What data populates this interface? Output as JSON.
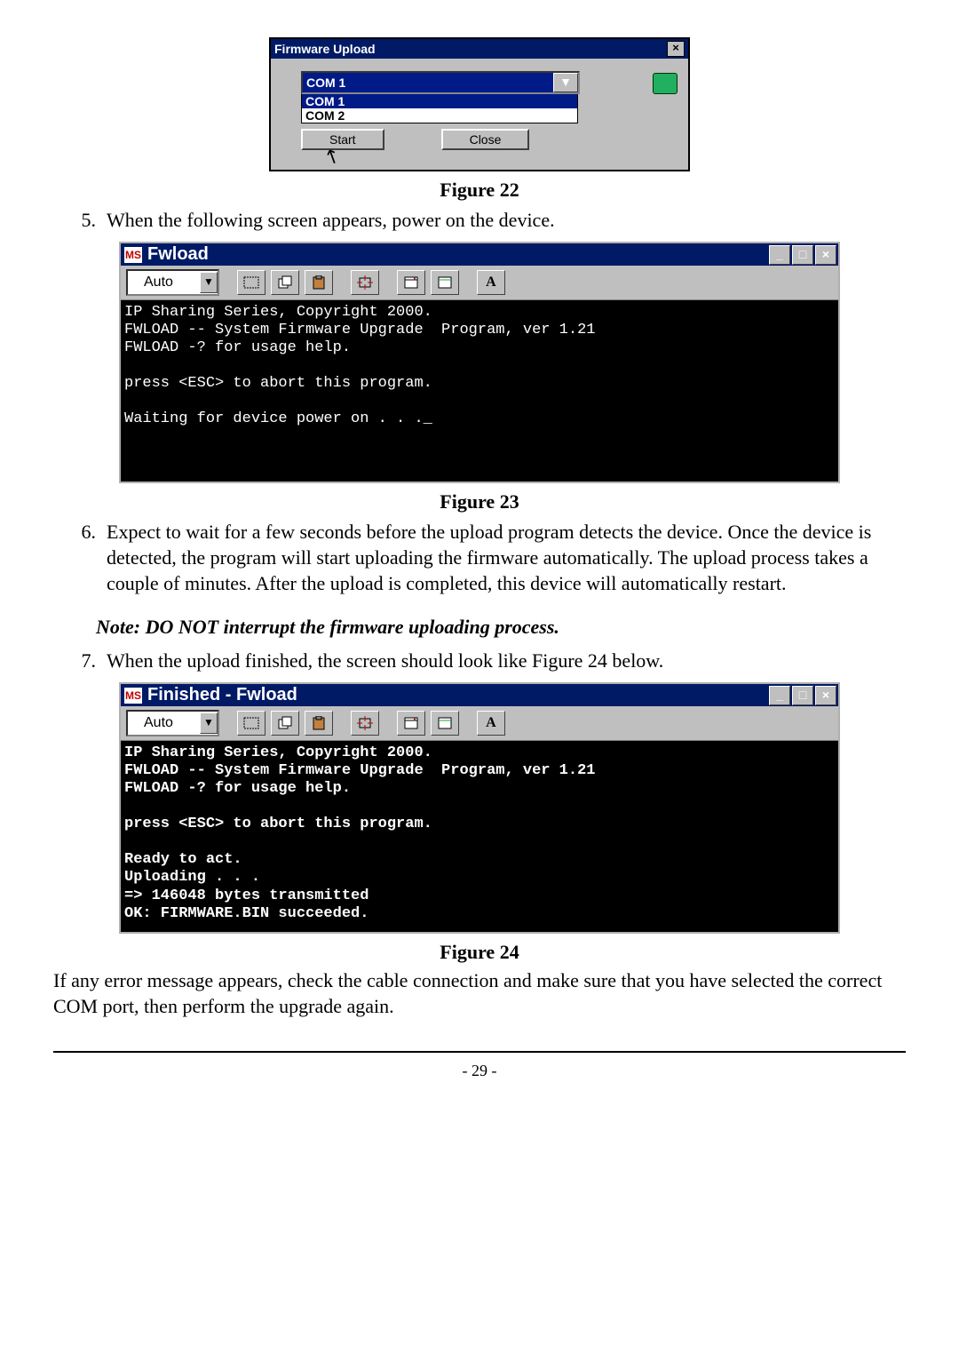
{
  "fig22": {
    "title": "Firmware Upload",
    "selected": "COM 1",
    "option1": "COM 1",
    "option2": "COM 2",
    "start": "Start",
    "close": "Close",
    "caption": "Figure 22"
  },
  "step5": {
    "num": "5.",
    "text": "When the following screen appears, power on the device."
  },
  "fig23": {
    "title": "Fwload",
    "combo": "Auto",
    "console": "IP Sharing Series, Copyright 2000.\nFWLOAD -- System Firmware Upgrade  Program, ver 1.21\nFWLOAD -? for usage help.\n\npress <ESC> to abort this program.\n\nWaiting for device power on . . ._",
    "caption": "Figure 23"
  },
  "step6": {
    "num": "6.",
    "text": "Expect to wait for a few seconds before the upload program detects the device. Once the device is detected, the program will start uploading the firmware automatically. The upload process takes a couple of minutes. After the upload is completed, this device will automatically restart."
  },
  "note": "Note: DO NOT interrupt the firmware uploading process.",
  "step7": {
    "num": "7.",
    "text": "When the upload finished, the screen should look like Figure 24 below."
  },
  "fig24": {
    "title": "Finished - Fwload",
    "combo": "Auto",
    "console": "IP Sharing Series, Copyright 2000.\nFWLOAD -- System Firmware Upgrade  Program, ver 1.21\nFWLOAD -? for usage help.\n\npress <ESC> to abort this program.\n\nReady to act.\nUploading . . .\n=> 146048 bytes transmitted\nOK: FIRMWARE.BIN succeeded.",
    "caption": "Figure 24"
  },
  "closing": "If any error message appears, check the cable connection and make sure that you have selected the correct COM port, then perform the upgrade again.",
  "pagenum": "- 29 -",
  "winbtns": {
    "min": "_",
    "max": "□",
    "close": "×"
  }
}
